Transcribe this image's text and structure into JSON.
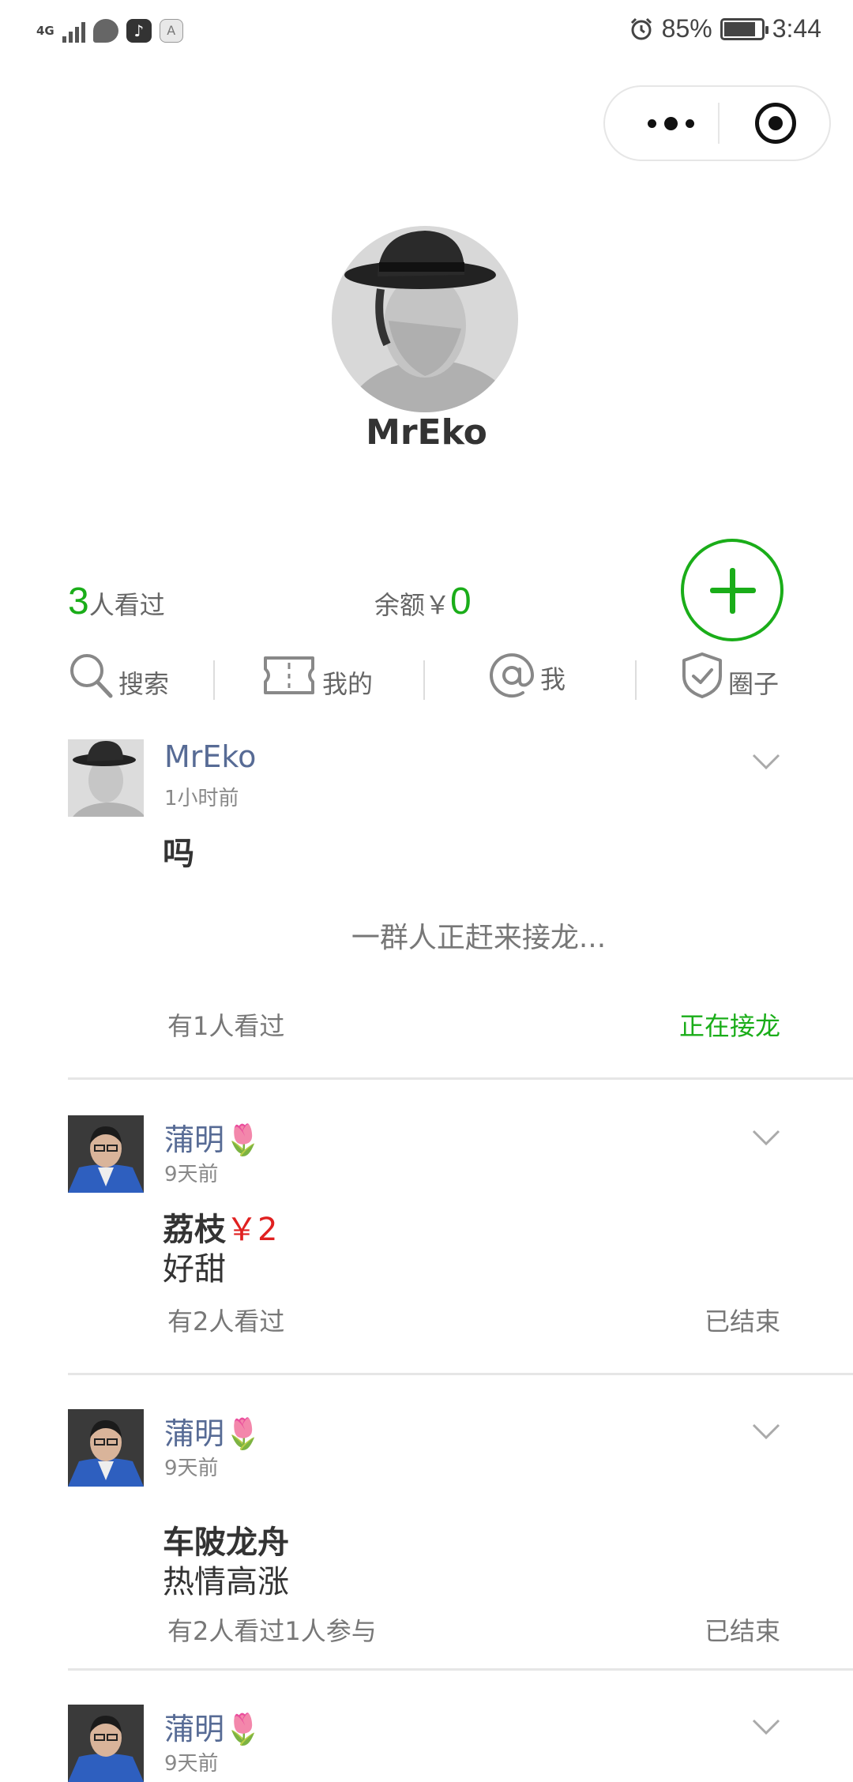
{
  "status_bar": {
    "network": "4G",
    "battery": "85%",
    "battery_level": 0.85,
    "time": "3:44",
    "app_icons": [
      "chat-icon",
      "tiktok-icon",
      "keyboard-a-icon"
    ],
    "keyboard_label": "A"
  },
  "profile": {
    "username": "MrEko"
  },
  "stats": {
    "views_count": "3",
    "views_label": "人看过",
    "balance_label": "余额￥",
    "balance_value": "0"
  },
  "nav": [
    {
      "label": "搜索",
      "icon": "search-icon"
    },
    {
      "label": "我的",
      "icon": "ticket-icon"
    },
    {
      "label": "我",
      "icon": "at-icon"
    },
    {
      "label": "圈子",
      "icon": "shield-check-icon"
    }
  ],
  "feed": [
    {
      "author": "MrEko",
      "flower": "",
      "time": "1小时前",
      "title": "吗",
      "price": "",
      "desc": "",
      "waiting": "一群人正赶来接龙...",
      "footer_left": "有1人看过",
      "footer_right": "正在接龙",
      "active": true
    },
    {
      "author": "蒲明",
      "flower": "🌷",
      "time": "9天前",
      "title": "荔枝",
      "price": "￥2",
      "desc": "好甜",
      "footer_left": "有2人看过",
      "footer_right": "已结束",
      "active": false
    },
    {
      "author": "蒲明",
      "flower": "🌷",
      "time": "9天前",
      "title": "车陂龙舟",
      "price": "",
      "desc": "热情高涨",
      "footer_left": "有2人看过1人参与",
      "footer_right": "已结束",
      "active": false
    },
    {
      "author": "蒲明",
      "flower": "🌷",
      "time": "9天前"
    }
  ],
  "colors": {
    "accent_green": "#1aad19",
    "author_blue": "#576b95",
    "price_red": "#e02020"
  }
}
